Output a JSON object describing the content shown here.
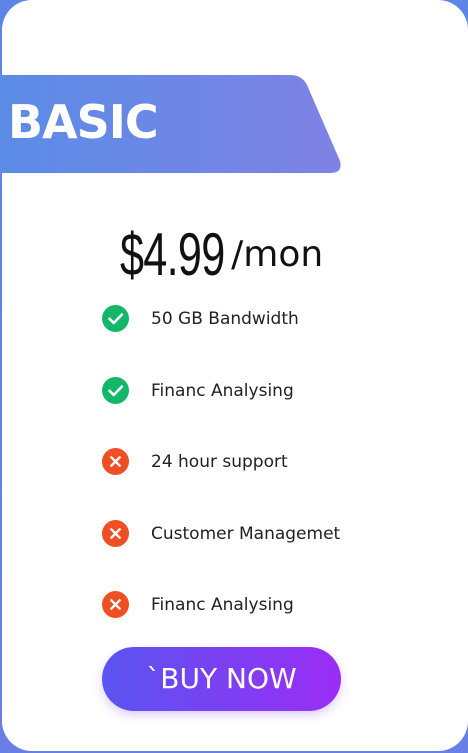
{
  "plan": {
    "name": "BASIC",
    "price": "$4.99",
    "period": "/mon"
  },
  "features": [
    {
      "label": "50 GB Bandwidth",
      "status": "included",
      "icon": "check-icon"
    },
    {
      "label": "Financ Analysing",
      "status": "included",
      "icon": "check-icon"
    },
    {
      "label": "24 hour support",
      "status": "excluded",
      "icon": "cross-icon"
    },
    {
      "label": "Customer Managemet",
      "status": "excluded",
      "icon": "cross-icon"
    },
    {
      "label": "Financ Analysing",
      "status": "excluded",
      "icon": "cross-icon"
    }
  ],
  "cta": {
    "label": "`BUY NOW"
  },
  "colors": {
    "included": "#12b76a",
    "excluded": "#f04e23",
    "ribbon_start": "#5b8ce6",
    "ribbon_end": "#7f82e4",
    "button_start": "#5a54f0",
    "button_end": "#9b2df5"
  }
}
